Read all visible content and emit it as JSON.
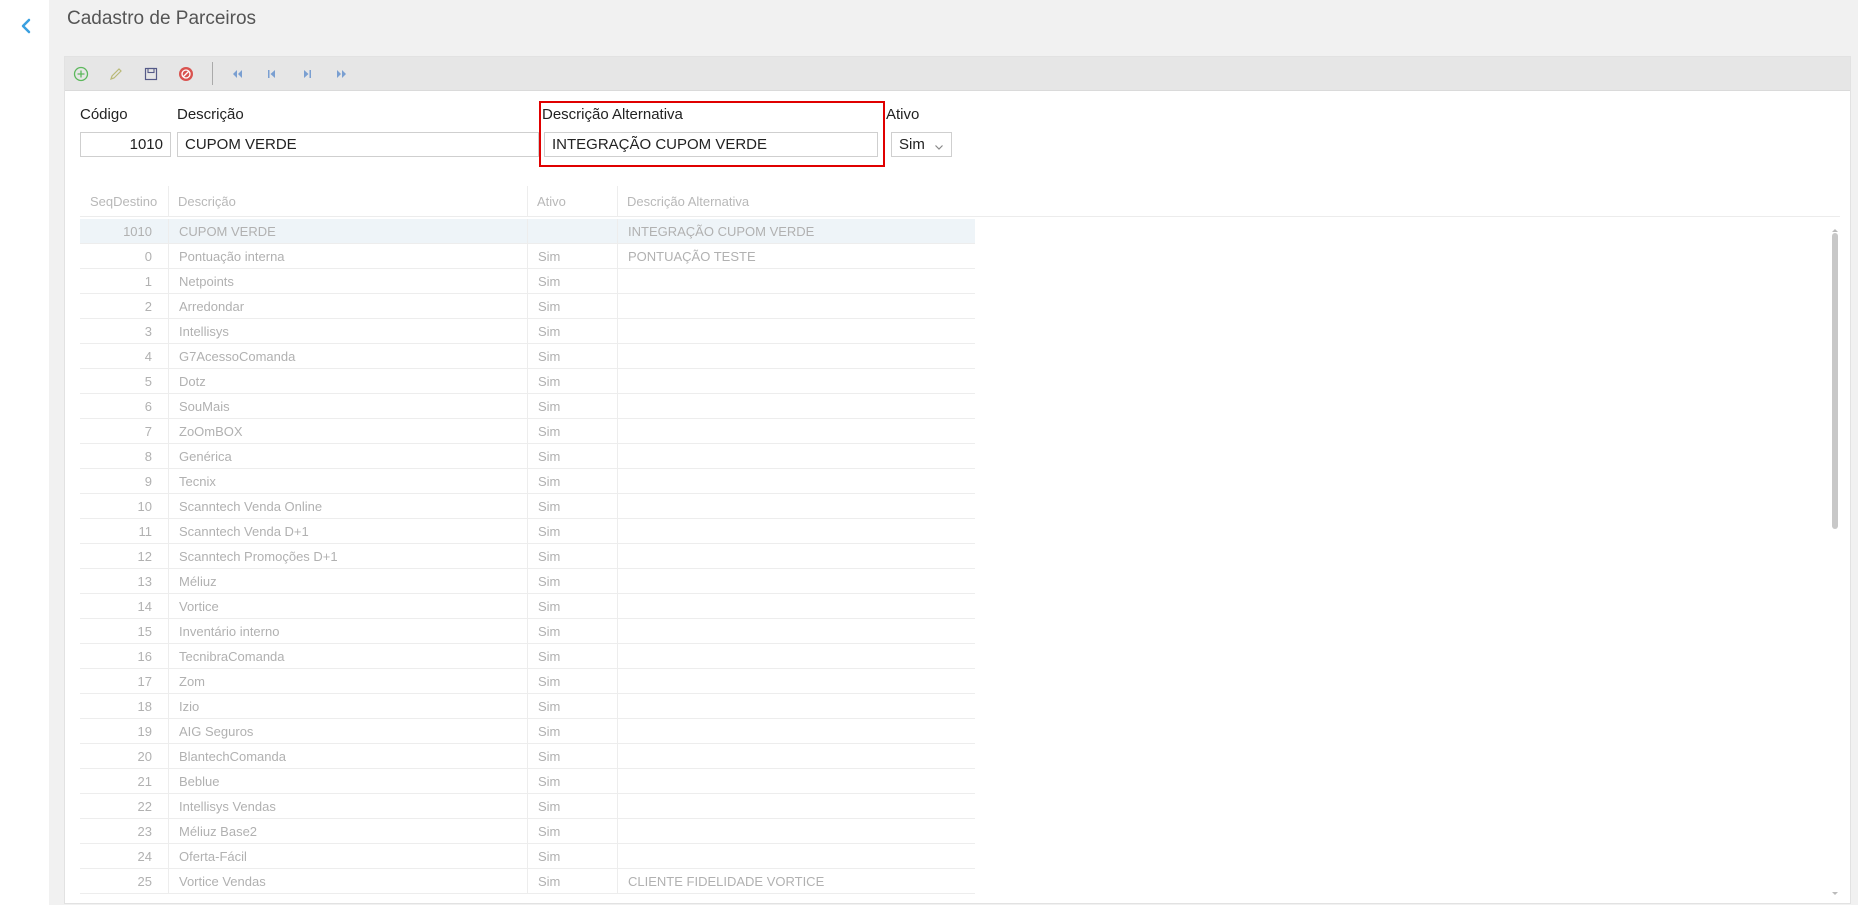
{
  "page": {
    "title": "Cadastro de Parceiros"
  },
  "toolbar": {
    "icons": [
      "add-icon",
      "edit-icon",
      "save-icon",
      "cancel-icon",
      "first-record-icon",
      "previous-record-icon",
      "next-record-icon",
      "last-record-icon"
    ]
  },
  "form": {
    "codigo": {
      "label": "Código",
      "value": "1010"
    },
    "descricao": {
      "label": "Descrição",
      "value": "CUPOM VERDE"
    },
    "descricao_alternativa": {
      "label": "Descrição Alternativa",
      "value": "INTEGRAÇÃO CUPOM VERDE"
    },
    "ativo": {
      "label": "Ativo",
      "value": "Sim"
    }
  },
  "grid": {
    "columns": [
      "SeqDestino",
      "Descrição",
      "Ativo",
      "Descrição Alternativa"
    ],
    "rows": [
      {
        "seq": "1010",
        "desc": "CUPOM VERDE",
        "ativo": "",
        "alt": "INTEGRAÇÃO CUPOM VERDE"
      },
      {
        "seq": "0",
        "desc": "Pontuação interna",
        "ativo": "Sim",
        "alt": "PONTUAÇÃO TESTE"
      },
      {
        "seq": "1",
        "desc": "Netpoints",
        "ativo": "Sim",
        "alt": ""
      },
      {
        "seq": "2",
        "desc": "Arredondar",
        "ativo": "Sim",
        "alt": ""
      },
      {
        "seq": "3",
        "desc": "Intellisys",
        "ativo": "Sim",
        "alt": ""
      },
      {
        "seq": "4",
        "desc": "G7AcessoComanda",
        "ativo": "Sim",
        "alt": ""
      },
      {
        "seq": "5",
        "desc": "Dotz",
        "ativo": "Sim",
        "alt": ""
      },
      {
        "seq": "6",
        "desc": "SouMais",
        "ativo": "Sim",
        "alt": ""
      },
      {
        "seq": "7",
        "desc": "ZoOmBOX",
        "ativo": "Sim",
        "alt": ""
      },
      {
        "seq": "8",
        "desc": "Genérica",
        "ativo": "Sim",
        "alt": ""
      },
      {
        "seq": "9",
        "desc": "Tecnix",
        "ativo": "Sim",
        "alt": ""
      },
      {
        "seq": "10",
        "desc": "Scanntech Venda Online",
        "ativo": "Sim",
        "alt": ""
      },
      {
        "seq": "11",
        "desc": "Scanntech Venda D+1",
        "ativo": "Sim",
        "alt": ""
      },
      {
        "seq": "12",
        "desc": "Scanntech Promoções D+1",
        "ativo": "Sim",
        "alt": ""
      },
      {
        "seq": "13",
        "desc": "Méliuz",
        "ativo": "Sim",
        "alt": ""
      },
      {
        "seq": "14",
        "desc": "Vortice",
        "ativo": "Sim",
        "alt": ""
      },
      {
        "seq": "15",
        "desc": "Inventário interno",
        "ativo": "Sim",
        "alt": ""
      },
      {
        "seq": "16",
        "desc": "TecnibraComanda",
        "ativo": "Sim",
        "alt": ""
      },
      {
        "seq": "17",
        "desc": "Zom",
        "ativo": "Sim",
        "alt": ""
      },
      {
        "seq": "18",
        "desc": "Izio",
        "ativo": "Sim",
        "alt": ""
      },
      {
        "seq": "19",
        "desc": "AIG Seguros",
        "ativo": "Sim",
        "alt": ""
      },
      {
        "seq": "20",
        "desc": "BlantechComanda",
        "ativo": "Sim",
        "alt": ""
      },
      {
        "seq": "21",
        "desc": "Beblue",
        "ativo": "Sim",
        "alt": ""
      },
      {
        "seq": "22",
        "desc": "Intellisys Vendas",
        "ativo": "Sim",
        "alt": ""
      },
      {
        "seq": "23",
        "desc": "Méliuz Base2",
        "ativo": "Sim",
        "alt": ""
      },
      {
        "seq": "24",
        "desc": "Oferta-Fácil",
        "ativo": "Sim",
        "alt": ""
      },
      {
        "seq": "25",
        "desc": "Vortice Vendas",
        "ativo": "Sim",
        "alt": "CLIENTE FIDELIDADE VORTICE"
      }
    ]
  },
  "colors": {
    "highlight": "#e00000",
    "accent": "#3aa0e0",
    "add_green": "#5cb85c",
    "cancel_red": "#d9534f",
    "nav_blue": "#7a9fd1"
  }
}
